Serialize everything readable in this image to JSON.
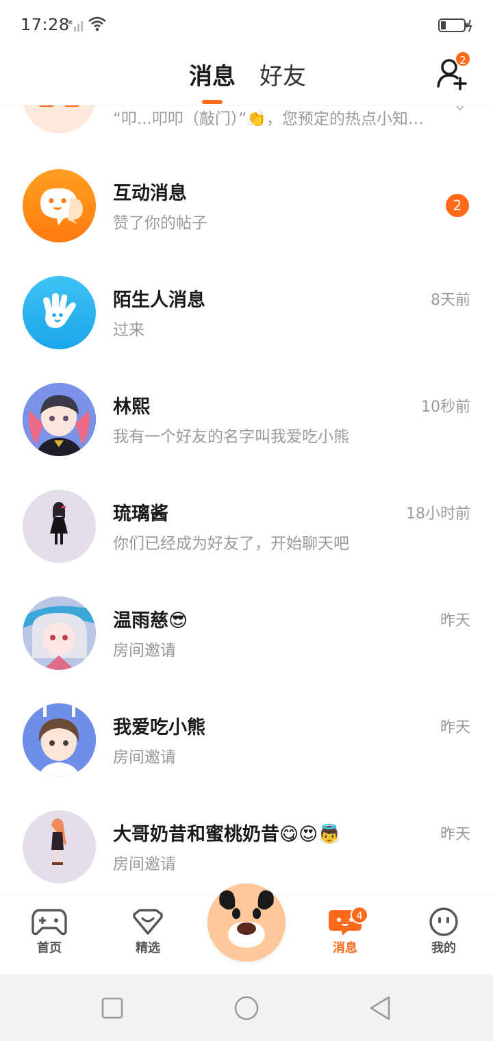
{
  "status_bar": {
    "time": "17:28"
  },
  "header": {
    "tab_messages": "消息",
    "tab_friends": "好友",
    "add_friend_badge": "2"
  },
  "conversations": [
    {
      "name": "",
      "preview": "“叩...叩叩（敲门）”👏，您预定的热点小知…",
      "time": "",
      "badge": ""
    },
    {
      "name": "互动消息",
      "preview": "赞了你的帖子",
      "time": "",
      "badge": "2"
    },
    {
      "name": "陌生人消息",
      "preview": "过来",
      "time": "8天前",
      "badge": ""
    },
    {
      "name": "林熙",
      "preview": "我有一个好友的名字叫我爱吃小熊",
      "time": "10秒前",
      "badge": ""
    },
    {
      "name": "琉璃酱",
      "preview": "你们已经成为好友了，开始聊天吧",
      "time": "18小时前",
      "badge": ""
    },
    {
      "name": "温雨慈😎",
      "preview": "房间邀请",
      "time": "昨天",
      "badge": ""
    },
    {
      "name": "我爱吃小熊",
      "preview": "房间邀请",
      "time": "昨天",
      "badge": ""
    },
    {
      "name": "大哥奶昔和蜜桃奶昔😋😍👼",
      "preview": "房间邀请",
      "time": "昨天",
      "badge": ""
    }
  ],
  "bottom_nav": {
    "items": [
      {
        "label": "首页",
        "icon": "gamepad-icon"
      },
      {
        "label": "精选",
        "icon": "heart-box-icon"
      },
      {
        "label": "消息",
        "icon": "chat-bubble-icon",
        "active": true,
        "badge": "4"
      },
      {
        "label": "我的",
        "icon": "face-icon"
      }
    ]
  },
  "colors": {
    "accent": "#ff6a1a",
    "text_primary": "#1a1a1a",
    "text_secondary": "#999999"
  }
}
